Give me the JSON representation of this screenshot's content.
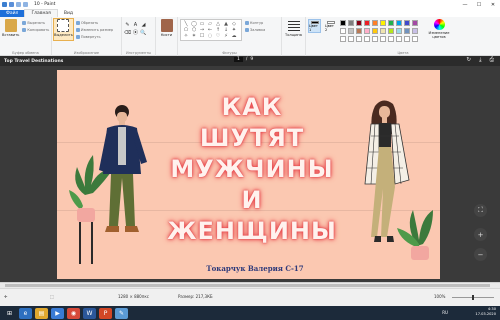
{
  "window": {
    "title": "10 - Paint",
    "controls": [
      "—",
      "☐",
      "✕"
    ]
  },
  "ribbon_tabs": {
    "file": "Файл",
    "home": "Главная",
    "view": "Вид"
  },
  "clipboard": {
    "paste": "Вставить",
    "cut": "Вырезать",
    "copy": "Копировать",
    "title": "Буфер обмена"
  },
  "image_group": {
    "select": "Выделить",
    "crop": "Обрезать",
    "resize": "Изменить размер",
    "rotate": "Повернуть",
    "title": "Изображение"
  },
  "tools_group": {
    "title": "Инструменты",
    "items": [
      "✎",
      "A",
      "◢",
      "⌫",
      "⦿",
      "🔍"
    ]
  },
  "brushes": {
    "label": "Кисти"
  },
  "shapes_group": {
    "title": "Фигуры",
    "items": [
      "╲",
      "◯",
      "▭",
      "▱",
      "△",
      "▲",
      "◇",
      "⬠",
      "⬡",
      "→",
      "←",
      "↑",
      "↓",
      "✦",
      "✧",
      "✶",
      "☐",
      "◌",
      "♡",
      "⚡",
      "☁"
    ],
    "outline": "Контур",
    "fill": "Заливка"
  },
  "size": {
    "label": "Толщина"
  },
  "colors": {
    "title": "Цвета",
    "color1_label": "Цвет 1",
    "color2_label": "Цвет 2",
    "color1": "#000000",
    "color2": "#ffffff",
    "edit_label": "Изменение цветов",
    "palette": [
      "#000000",
      "#7f7f7f",
      "#880015",
      "#ed1c24",
      "#ff7f27",
      "#fff200",
      "#22b14c",
      "#00a2e8",
      "#3f48cc",
      "#a349a4",
      "#ffffff",
      "#c3c3c3",
      "#b97a57",
      "#ffaec9",
      "#ffc90e",
      "#efe4b0",
      "#b5e61d",
      "#99d9ea",
      "#7092be",
      "#c8bfe7",
      "#ffffff",
      "#ffffff",
      "#ffffff",
      "#ffffff",
      "#ffffff",
      "#ffffff",
      "#ffffff",
      "#ffffff",
      "#ffffff",
      "#ffffff"
    ]
  },
  "viewer": {
    "doc_title": "Top Travel Destinations",
    "page_current": "1",
    "page_sep": "/",
    "page_total": "9"
  },
  "slide": {
    "headline_lines": [
      "КАК",
      "ШУТЯТ",
      "МУЖЧИНЫ",
      "И",
      "ЖЕНЩИНЫ"
    ],
    "author": "Токарчук Валерия С-17"
  },
  "status": {
    "dimensions": "1280 × 880пкс",
    "filesize": "Размер: 217,3КБ",
    "zoom": "100%"
  },
  "taskbar": {
    "lang": "RU",
    "time": "4:30",
    "date": "17.03.2020"
  }
}
